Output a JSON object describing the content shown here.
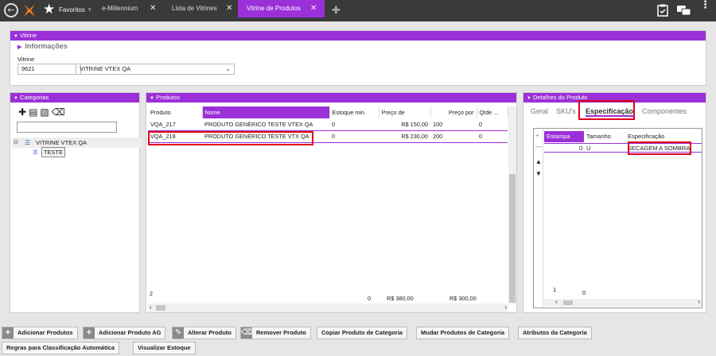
{
  "top_bar": {
    "favorites_label": "Favoritos",
    "tabs": [
      {
        "label": "e-Millennium"
      },
      {
        "label": "Lista de Vitrines"
      },
      {
        "label": "Vitrine de Produtos"
      }
    ],
    "icons": [
      "back-icon",
      "logo-icon",
      "star-icon",
      "add-tab-icon",
      "clipboard-icon",
      "chat-icon",
      "more-icon"
    ]
  },
  "vitrine": {
    "section_title": "Vitrine",
    "info_title": "Informações",
    "field_label": "Vitrine",
    "code_value": "9621",
    "select_value": "VITRINE VTEX QA"
  },
  "categorias": {
    "title": "Categorias",
    "tree_root": "VITRINE VTEX QA",
    "tree_child": "TESTE"
  },
  "produtos": {
    "title": "Produtos",
    "columns": [
      "Produto",
      "Nome",
      "Estoque min",
      "Preço de",
      "Preço por",
      "Qtde ..."
    ],
    "rows": [
      [
        "VQA_217",
        "PRODUTO GENÉRICO TESTE VTEX QA",
        "0",
        "R$ 150,00",
        "100",
        "0"
      ],
      [
        "VQA_218",
        "PRODUTO GENÉRICO TESTE VTX QA",
        "0",
        "R$ 230,00",
        "200",
        "0"
      ]
    ],
    "footer": {
      "count": "2",
      "estoque": "0",
      "preco_de": "R$ 380,00",
      "preco_por": "R$ 300,00"
    }
  },
  "detalhes": {
    "title": "Detalhes do Produto",
    "tabs": [
      "Geral",
      "SKU's",
      "Especificação",
      "Componentes"
    ],
    "active_tab": "Especificação",
    "columns": [
      "Estampa",
      "Tamanho",
      "Especificação"
    ],
    "row": {
      "estampa": "0",
      "tamanho": "U",
      "especificacao": "SECAGEM A SOMBRA"
    },
    "footer": {
      "count": "1",
      "estampa": "0"
    }
  },
  "buttons": {
    "row1": [
      "Adicionar Produtos",
      "Adicionar Produto AG",
      "Alterar Produto",
      "Remover Produto",
      "Copiar Produto de Categoria",
      "Mudar Produtos de Categoria",
      "Atributos da Categoria"
    ],
    "row2": [
      "Regras para Classificação Automática",
      "Visualizar Estoque"
    ]
  },
  "colors": {
    "accent": "#9b30d9",
    "highlight": "#e0001a",
    "topbar": "#3a3a3a"
  }
}
